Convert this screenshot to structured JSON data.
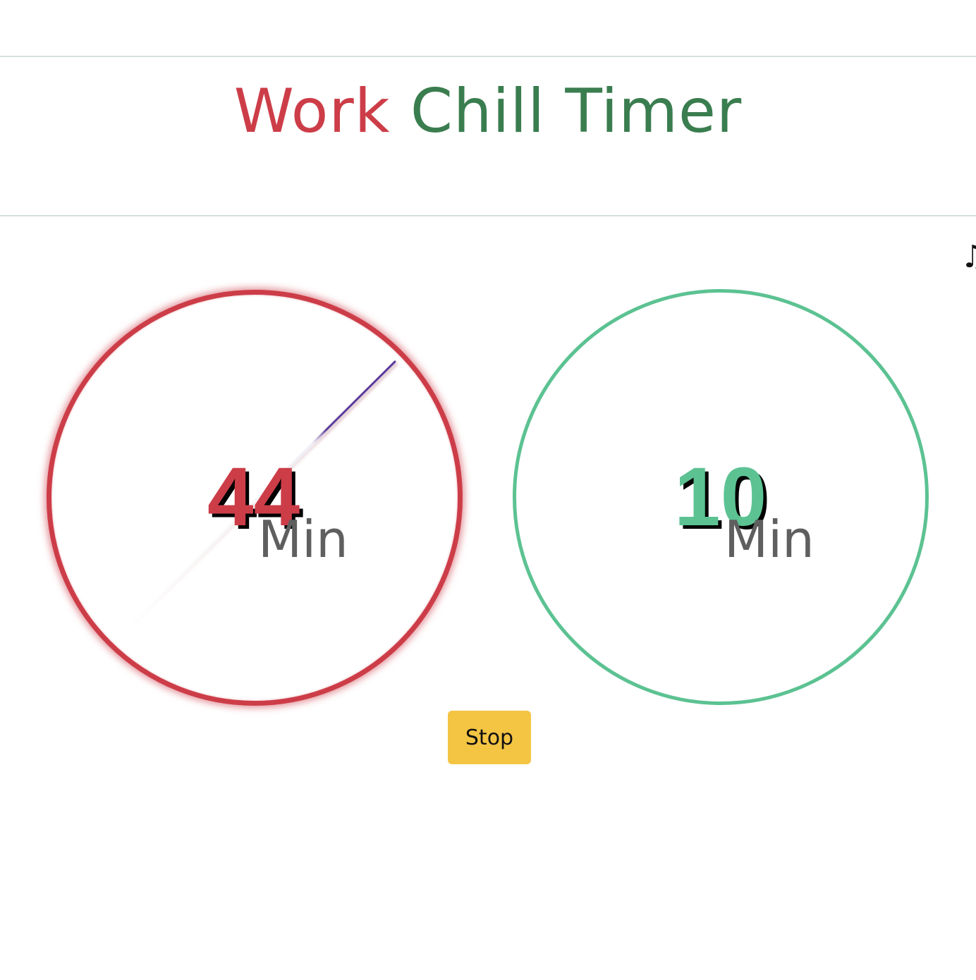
{
  "header": {
    "title_work": "Work",
    "title_chill": "Chill Timer"
  },
  "music": {
    "icon": "music-note-icon",
    "glyph": "♫"
  },
  "work_timer": {
    "value": "44",
    "unit": "Min",
    "color": "#cc3d48"
  },
  "chill_timer": {
    "value": "10",
    "unit": "Min",
    "color": "#5cc292"
  },
  "controls": {
    "stop_label": "Stop",
    "stop_color": "#f4c443"
  },
  "colors": {
    "hand": "#5a3d9a",
    "divider": "#d6dfe0",
    "unit_text": "#5f5f5f"
  }
}
